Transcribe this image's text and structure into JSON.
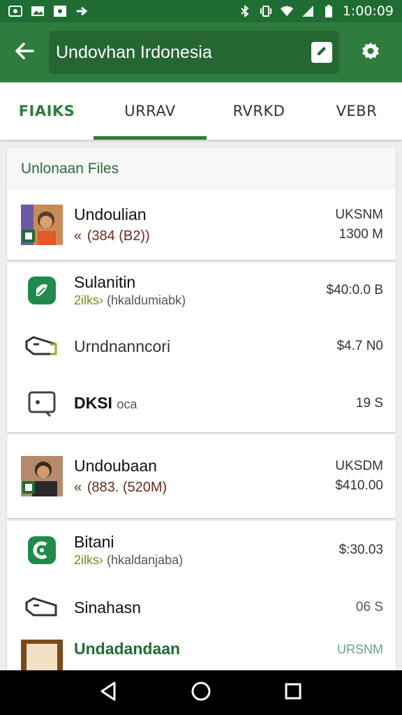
{
  "status_bar": {
    "time": "1:00:09",
    "left_icons": [
      "photo-icon",
      "image-icon",
      "square-icon",
      "arrow-icon"
    ],
    "right_icons": [
      "bluetooth-icon",
      "vibrate-icon",
      "wifi-icon",
      "signal-icon",
      "battery-icon"
    ]
  },
  "app_bar": {
    "search_text": "Undovhan Irdonesia"
  },
  "tabs": [
    {
      "label": "FIAIKS"
    },
    {
      "label": "URRAV"
    },
    {
      "label": "RVRKD"
    },
    {
      "label": "VEBR"
    }
  ],
  "section": {
    "title": "Unlonaan Files"
  },
  "items": [
    {
      "title": "Undoulian",
      "sub_chevron": "«",
      "sub_text": "(384  (B2))",
      "meta_top": "UKSNM",
      "meta_bottom": "1300 M"
    },
    {
      "title": "Sulanitin",
      "sub_highlight": "2ilks›",
      "sub_text": "(hkaldumiabk)",
      "meta": "$40:0.0 B"
    },
    {
      "title": "Urndnanncori",
      "meta": "$4.7 N0"
    },
    {
      "title": "DKSI",
      "title_extra": "oca",
      "meta": "19 S"
    },
    {
      "title": "Undoubaan",
      "sub_chevron": "«",
      "sub_text": "(883. (520M)",
      "meta_top": "UKSDM",
      "meta_bottom": "$410.00"
    },
    {
      "title": "Bitani",
      "sub_highlight": "2ilks›",
      "sub_text": "(hkaldanjaba)",
      "meta": "$:30.03"
    },
    {
      "title": "Sinahasn",
      "meta": "06 S"
    },
    {
      "title": "Undadandaan",
      "meta": "URSNM"
    }
  ],
  "colors": {
    "primary": "#2f7d3e",
    "primary_dark": "#1f6d33",
    "accent_text": "#2a6b3c"
  }
}
